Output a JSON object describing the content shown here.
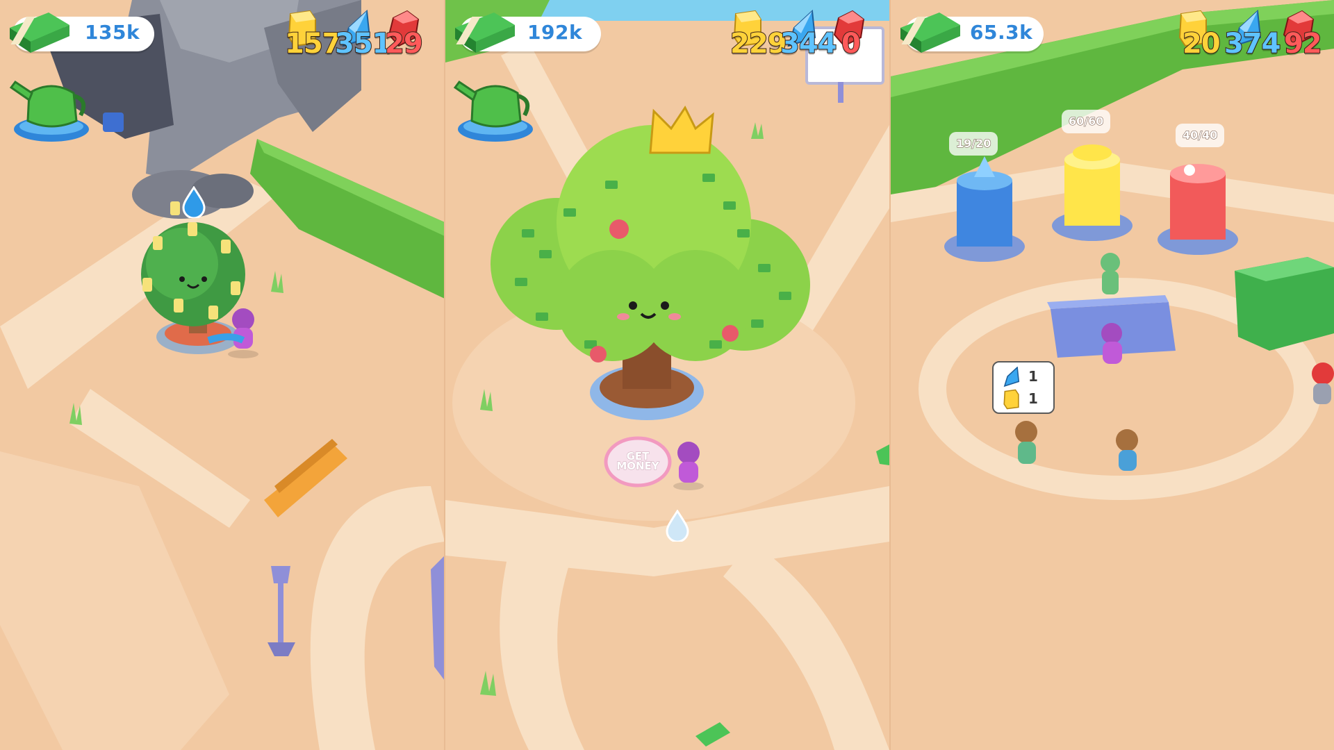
{
  "panels": [
    {
      "money": "135k",
      "gold": "157",
      "crystal": "351",
      "ruby": "29"
    },
    {
      "money": "192k",
      "gold": "229",
      "crystal": "344",
      "ruby": "0",
      "get_money_label": "GET MONEY"
    },
    {
      "money": "65.3k",
      "gold": "20",
      "crystal": "374",
      "ruby": "92",
      "stacks": {
        "crystal": "19/20",
        "gold": "60/60",
        "ruby": "40/40"
      },
      "order_bubble": {
        "crystal": "1",
        "gold": "1"
      }
    }
  ],
  "colors": {
    "ground": "#f2c9a2",
    "path": "#f8e0c4",
    "grass": "#6fc24a",
    "rock": "#8a8f9c",
    "money_text": "#2f86d9",
    "gold": "#ffd23a",
    "crystal": "#5fc3ff",
    "ruby": "#ff5a5a"
  },
  "icons": [
    "cash-stack-icon",
    "gold-bar-icon",
    "blue-crystal-icon",
    "red-ruby-icon",
    "watering-can-icon",
    "water-drop-icon"
  ]
}
